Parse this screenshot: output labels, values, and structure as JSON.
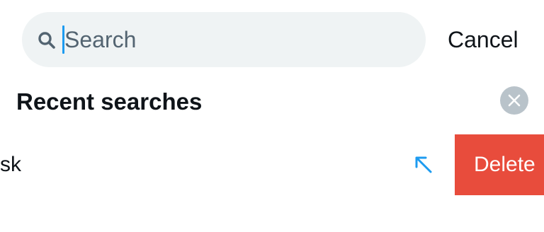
{
  "search": {
    "placeholder": "Search",
    "value": "",
    "cancel_label": "Cancel",
    "icon": "search-icon"
  },
  "recent": {
    "title": "Recent searches",
    "clear_icon": "close-circle-icon",
    "items": [
      {
        "text": "sk",
        "fill_icon": "arrow-up-left-icon",
        "delete_label": "Delete"
      }
    ]
  },
  "colors": {
    "accent": "#1d9bf0",
    "delete": "#e84c3c",
    "search_bg": "#eff3f4",
    "clear_bg": "#b9c3ca"
  }
}
